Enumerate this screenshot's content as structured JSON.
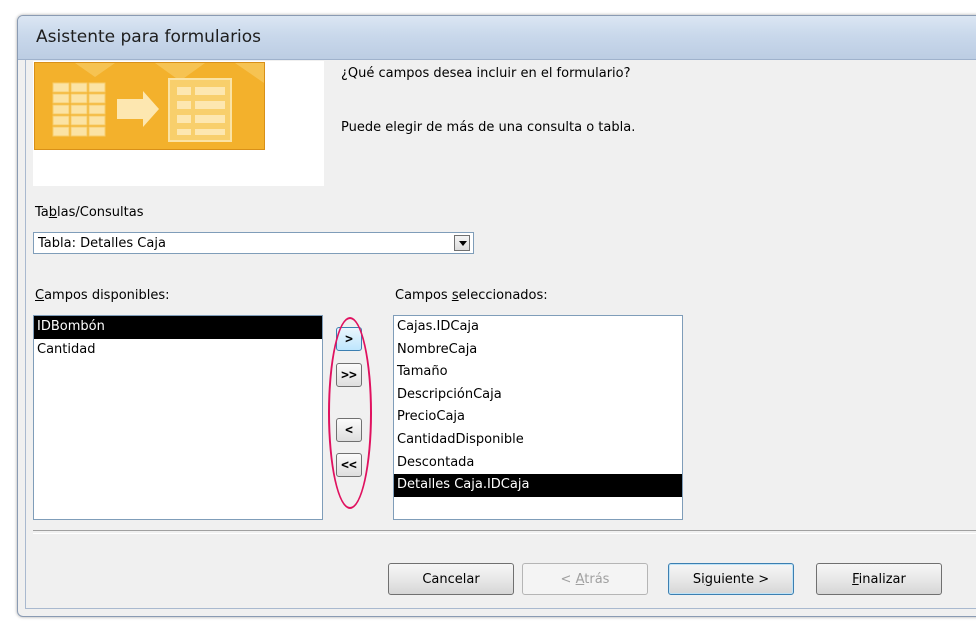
{
  "window": {
    "title": "Asistente para formularios"
  },
  "intro": {
    "question": "¿Qué campos desea incluir en el formulario?",
    "hint": "Puede elegir de más de una consulta o tabla."
  },
  "tables_queries": {
    "label_pre": "Ta",
    "label_accel": "b",
    "label_post": "las/Consultas",
    "selected_value": "Tabla: Detalles Caja"
  },
  "available_fields": {
    "label_accel": "C",
    "label_post": "ampos disponibles:",
    "items": [
      "IDBombón",
      "Cantidad"
    ],
    "selected_index": 0
  },
  "selected_fields": {
    "label_pre": "Campos ",
    "label_accel": "s",
    "label_post": "eleccionados:",
    "items": [
      "Cajas.IDCaja",
      "NombreCaja",
      "Tamaño",
      "DescripciónCaja",
      "PrecioCaja",
      "CantidadDisponible",
      "Descontada",
      "Detalles Caja.IDCaja"
    ],
    "selected_index": 7
  },
  "move_buttons": {
    "add_one": ">",
    "add_all": ">>",
    "remove_one": "<",
    "remove_all": "<<"
  },
  "buttons": {
    "cancel": "Cancelar",
    "back_pre": "< ",
    "back_accel": "A",
    "back_post": "trás",
    "next_pre": "Si",
    "next_accel": "g",
    "next_post": "uiente >",
    "finish_accel": "F",
    "finish_post": "inalizar"
  },
  "colors": {
    "highlight_oval": "#e0115f",
    "wizard_image": "#f3b12c",
    "selection": "#000000"
  }
}
